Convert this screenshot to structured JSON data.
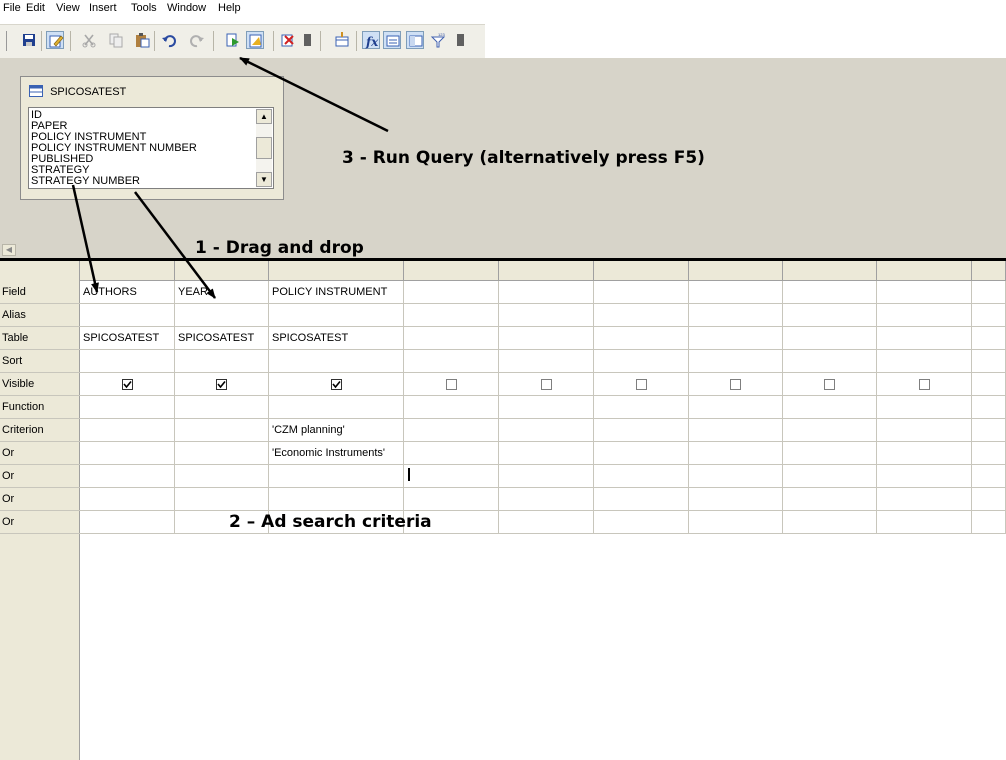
{
  "menu": [
    "File",
    "Edit",
    "View",
    "Insert",
    "Tools",
    "Window",
    "Help"
  ],
  "toolbar_icons": [
    "save-icon",
    "edit-icon",
    "cut-icon",
    "copy-icon",
    "paste-icon",
    "undo-icon",
    "redo-icon",
    "run-query-icon",
    "design-view-icon",
    "clear-icon",
    "dropdown-icon",
    "table-icon",
    "function-icon",
    "alias-icon",
    "table-name-icon",
    "distinct-icon",
    "dropdown-icon"
  ],
  "table_box": {
    "name": "SPICOSATEST",
    "fields": [
      "ID",
      "PAPER",
      "POLICY INSTRUMENT",
      "POLICY INSTRUMENT NUMBER",
      "PUBLISHED",
      "STRATEGY",
      "STRATEGY NUMBER"
    ]
  },
  "grid": {
    "row_labels": [
      "Field",
      "Alias",
      "Table",
      "Sort",
      "Visible",
      "Function",
      "Criterion",
      "Or",
      "Or",
      "Or",
      "Or"
    ],
    "columns": [
      {
        "field": "AUTHORS",
        "table": "SPICOSATEST",
        "visible": true,
        "criterion": "",
        "or1": ""
      },
      {
        "field": "YEAR",
        "table": "SPICOSATEST",
        "visible": true,
        "criterion": "",
        "or1": ""
      },
      {
        "field": "POLICY INSTRUMENT",
        "table": "SPICOSATEST",
        "visible": true,
        "criterion": "'CZM planning'",
        "or1": "'Economic Instruments'"
      },
      {
        "field": "",
        "table": "",
        "visible": false,
        "criterion": "",
        "or1": ""
      },
      {
        "field": "",
        "table": "",
        "visible": false,
        "criterion": "",
        "or1": ""
      },
      {
        "field": "",
        "table": "",
        "visible": false,
        "criterion": "",
        "or1": ""
      },
      {
        "field": "",
        "table": "",
        "visible": false,
        "criterion": "",
        "or1": ""
      },
      {
        "field": "",
        "table": "",
        "visible": false,
        "criterion": "",
        "or1": ""
      },
      {
        "field": "",
        "table": "",
        "visible": false,
        "criterion": "",
        "or1": ""
      }
    ]
  },
  "annotations": {
    "run_query": "3 - Run Query (alternatively press F5)",
    "drag_drop": "1 - Drag and drop",
    "criteria": "2 – Ad search criteria"
  },
  "colors": {
    "chrome": "#ece9d8",
    "design_pane": "#d7d4c9",
    "toolbar": "#f0efe8"
  }
}
